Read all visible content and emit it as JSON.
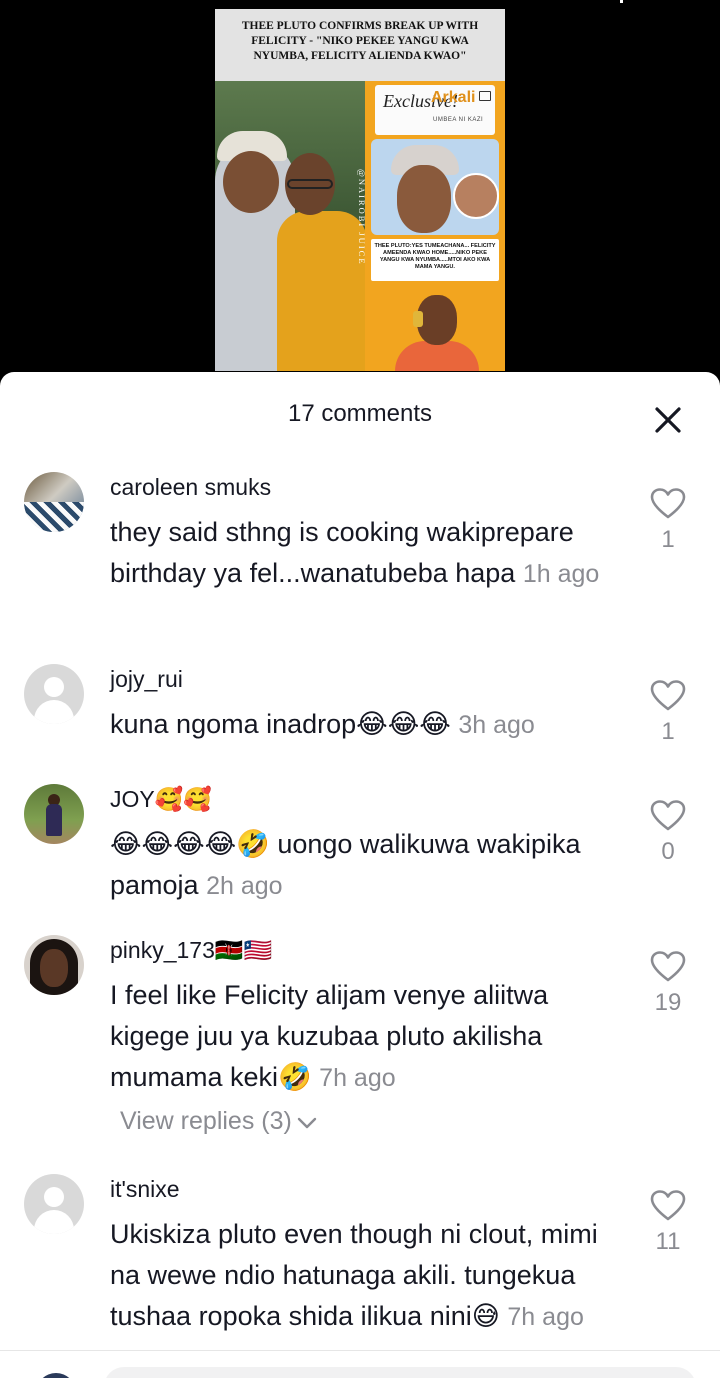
{
  "media": {
    "headline": "THEE PLUTO CONFIRMS BREAK UP WITH FELICITY - \"NIKO PEKEE YANGU KWA NYUMBA, FELICITY ALIENDA KWAO\"",
    "watermark": "@NAIROBI JUICE",
    "brand_script": "Exclusive!",
    "brand_name": "Arkali",
    "brand_tagline": "UMBEA NI KAZI",
    "quote": "THEE PLUTO:YES TUMEACHANA... FELICITY AMEENDA KWAO HOME.....NIKO PEKE YANGU KWA NYUMBA.....MTOI AKO KWA MAMA YANGU.",
    "accent_color": "#f2a51f"
  },
  "sheet": {
    "title": "17 comments",
    "close_icon": "close-icon"
  },
  "comments": [
    {
      "username": "caroleen smuks",
      "text": "they said sthng is cooking wakiprepare birthday ya fel...wanatubeba hapa",
      "time": "1h ago",
      "likes": "1"
    },
    {
      "username": "jojy_rui",
      "text": "kuna ngoma inadrop😂😂😂",
      "time": "3h ago",
      "likes": "1"
    },
    {
      "username": "JOY🥰🥰",
      "text": "😂😂😂😂🤣 uongo walikuwa wakipika pamoja",
      "time": "2h ago",
      "likes": "0"
    },
    {
      "username": "pinky_173🇰🇪🇱🇷",
      "text": "I feel like Felicity alijam venye aliitwa kigege juu ya kuzubaa pluto akilisha mumama keki🤣",
      "time": "7h ago",
      "likes": "19",
      "replies_label": "View replies (3)"
    },
    {
      "username": "it'snixe",
      "text": "Ukiskiza pluto even though ni clout, mimi na wewe ndio hatunaga akili. tungekua tushaa ropoka shida ilikua nini😅",
      "time": "7h ago",
      "likes": "11"
    }
  ]
}
